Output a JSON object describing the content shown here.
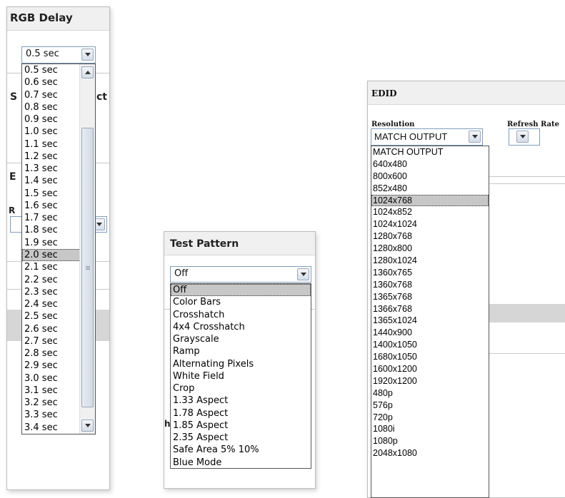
{
  "rgb_delay": {
    "title": "RGB Delay",
    "selected_value": "0.5 sec",
    "options": [
      "0.5 sec",
      "0.6 sec",
      "0.7 sec",
      "0.8 sec",
      "0.9 sec",
      "1.0 sec",
      "1.1 sec",
      "1.2 sec",
      "1.3 sec",
      "1.4 sec",
      "1.5 sec",
      "1.6 sec",
      "1.7 sec",
      "1.8 sec",
      "1.9 sec",
      "2.0 sec",
      "2.1 sec",
      "2.2 sec",
      "2.3 sec",
      "2.4 sec",
      "2.5 sec",
      "2.6 sec",
      "2.7 sec",
      "2.8 sec",
      "2.9 sec",
      "3.0 sec",
      "3.1 sec",
      "3.2 sec",
      "3.3 sec",
      "3.4 sec"
    ],
    "highlighted_option": "2.0 sec",
    "background_fragments": {
      "s_label": "S",
      "ct_label": "ct",
      "e_label": "E",
      "r_label": "R"
    }
  },
  "test_pattern": {
    "title": "Test Pattern",
    "selected_value": "Off",
    "options": [
      "Off",
      "Color Bars",
      "Crosshatch",
      "4x4 Crosshatch",
      "Grayscale",
      "Ramp",
      "Alternating Pixels",
      "White Field",
      "Crop",
      "1.33 Aspect",
      "1.78 Aspect",
      "1.85 Aspect",
      "2.35 Aspect",
      "Safe Area 5% 10%",
      "Blue Mode"
    ],
    "highlighted_option": "Off",
    "background_fragments": {
      "h_label": "h"
    }
  },
  "edid": {
    "title": "EDID",
    "resolution_label": "Resolution",
    "refresh_rate_label": "Refresh Rate",
    "resolution_value": "MATCH OUTPUT",
    "refresh_rate_value": "",
    "options": [
      "MATCH OUTPUT",
      "640x480",
      "800x600",
      "852x480",
      "1024x768",
      "1024x852",
      "1024x1024",
      "1280x768",
      "1280x800",
      "1280x1024",
      "1360x765",
      "1360x768",
      "1365x768",
      "1366x768",
      "1365x1024",
      "1440x900",
      "1400x1050",
      "1680x1050",
      "1600x1200",
      "1920x1200",
      "480p",
      "576p",
      "720p",
      "1080i",
      "1080p",
      "2048x1080"
    ],
    "highlighted_option": "1024x768"
  },
  "colors": {
    "highlight": "#c7c7c7",
    "combo_border": "#7f9db9",
    "panel_header": "#f0f0f0"
  },
  "icons": {
    "dropdown_arrow": "chevron-down-icon",
    "scroll_up": "scroll-up-icon",
    "scroll_down": "scroll-down-icon"
  }
}
